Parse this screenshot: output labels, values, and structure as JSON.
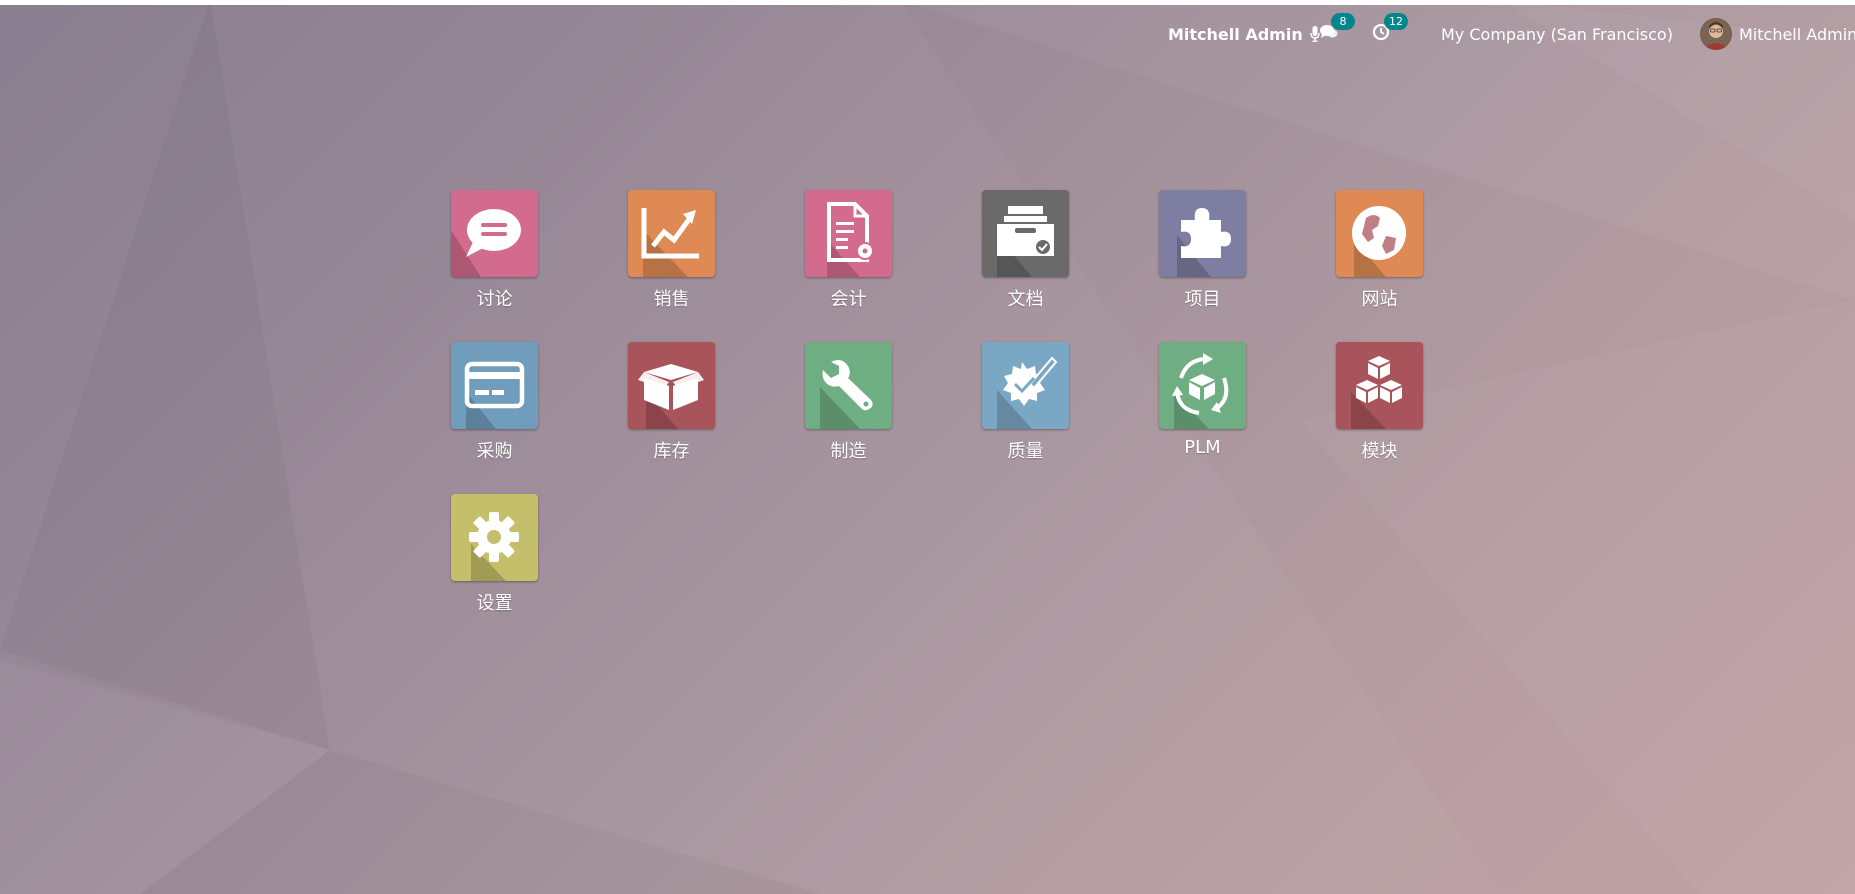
{
  "navbar": {
    "user_name_strong": "Mitchell Admin",
    "messages_count": "8",
    "activities_count": "12",
    "company": "My Company (San Francisco)",
    "user_name": "Mitchell Admin"
  },
  "colors": {
    "badge": "#00868b"
  },
  "apps": [
    {
      "label": "讨论",
      "icon": "chat-bubble-icon",
      "color": "#d36b8e"
    },
    {
      "label": "销售",
      "icon": "sales-chart-icon",
      "color": "#df8a54"
    },
    {
      "label": "会计",
      "icon": "accounting-document-icon",
      "color": "#d36b8e"
    },
    {
      "label": "文档",
      "icon": "document-inbox-icon",
      "color": "#6a6a6a"
    },
    {
      "label": "项目",
      "icon": "puzzle-piece-icon",
      "color": "#7e7ea3"
    },
    {
      "label": "网站",
      "icon": "globe-icon",
      "color": "#df8a54"
    },
    {
      "label": "采购",
      "icon": "credit-card-icon",
      "color": "#6f9dbb"
    },
    {
      "label": "库存",
      "icon": "open-box-icon",
      "color": "#a9545b"
    },
    {
      "label": "制造",
      "icon": "wrench-icon",
      "color": "#6fae82"
    },
    {
      "label": "质量",
      "icon": "quality-badge-icon",
      "color": "#7aa8c4"
    },
    {
      "label": "PLM",
      "icon": "plm-cycle-icon",
      "color": "#6fae82"
    },
    {
      "label": "模块",
      "icon": "modules-cubes-icon",
      "color": "#a9545b"
    },
    {
      "label": "设置",
      "icon": "gear-icon",
      "color": "#c5be6a"
    }
  ]
}
